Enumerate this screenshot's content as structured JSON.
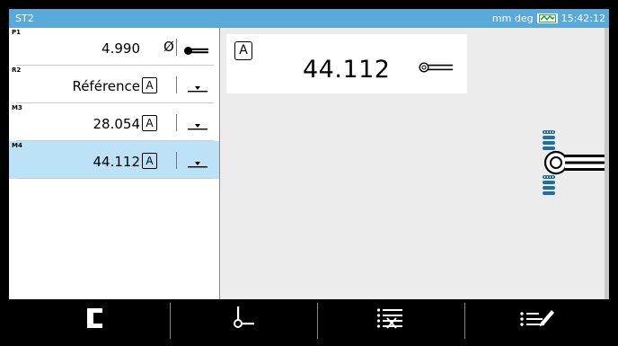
{
  "titlebar": {
    "app_name": "ST2",
    "units": "mm deg",
    "time": "15:42:12"
  },
  "measurements": [
    {
      "tag": "P1",
      "value": "4.990",
      "symbol": "diameter-icon",
      "action_icon": "probe-icon"
    },
    {
      "tag": "R2",
      "value": "Référence",
      "badge": "A",
      "action_icon": "datum-icon"
    },
    {
      "tag": "M3",
      "value": "28.054",
      "badge": "A",
      "action_icon": "datum-icon"
    },
    {
      "tag": "M4",
      "value": "44.112",
      "badge": "A",
      "action_icon": "datum-icon",
      "selected": true
    }
  ],
  "readout": {
    "badge": "A",
    "value": "44.112"
  },
  "toolbar": {
    "items": [
      "bracket-icon",
      "probe-point-icon",
      "delete-list-icon",
      "edit-list-icon"
    ]
  },
  "colors": {
    "titlebar": "#5aa9db",
    "selected_row": "#bde1f6",
    "view_background": "#ececec",
    "probe_blue": "#1f6ea8"
  }
}
